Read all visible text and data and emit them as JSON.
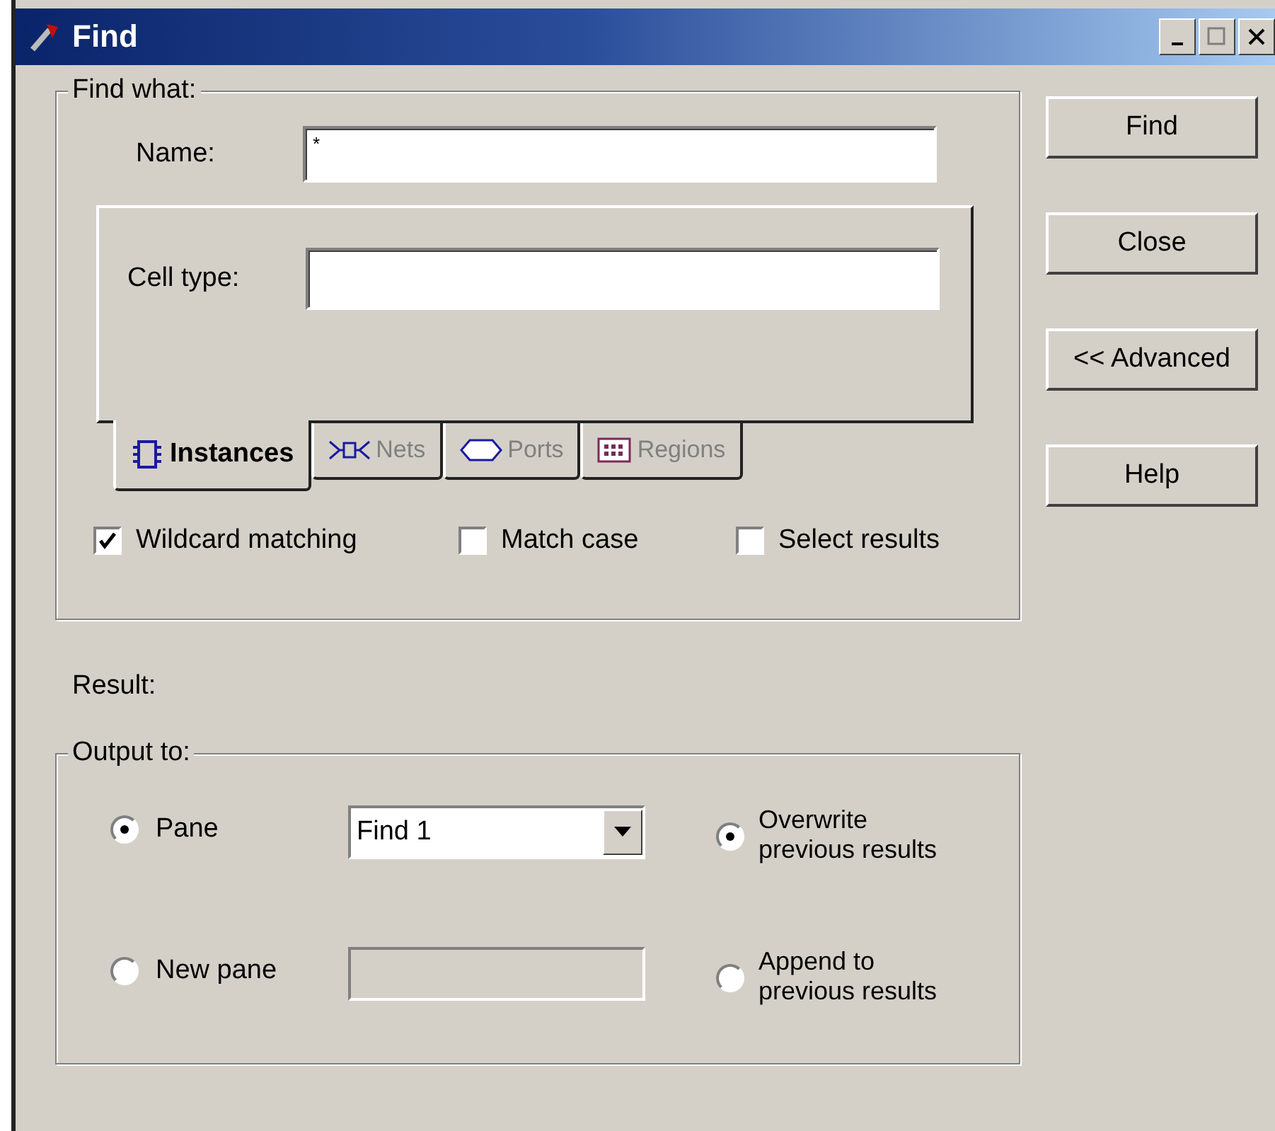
{
  "window": {
    "title": "Find"
  },
  "find_what": {
    "label": "Find what:",
    "name_field": {
      "label": "Name:",
      "value": "*"
    },
    "cell_type_field": {
      "label": "Cell type:"
    },
    "tabs": [
      {
        "label": "Instances",
        "kind": "instances",
        "selected": true
      },
      {
        "label": "Nets",
        "kind": "nets",
        "selected": false
      },
      {
        "label": "Ports",
        "kind": "ports",
        "selected": false
      },
      {
        "label": "Regions",
        "kind": "regions",
        "selected": false
      }
    ],
    "options": [
      {
        "label": "Wildcard matching",
        "checked": true
      },
      {
        "label": "Match case",
        "checked": false
      },
      {
        "label": "Select results",
        "checked": false
      }
    ]
  },
  "result": {
    "label": "Result:"
  },
  "output_to": {
    "label": "Output to:",
    "targets": [
      {
        "label": "Pane",
        "kind": "dropdown",
        "value": "Find 1",
        "selected": true
      },
      {
        "label": "New pane",
        "kind": "field",
        "disabled": true,
        "selected": false
      }
    ],
    "modes": [
      {
        "label": "Overwrite previous results",
        "selected": true
      },
      {
        "label": "Append to previous results",
        "selected": false
      }
    ]
  },
  "buttons": [
    "Find",
    "Close",
    "<< Advanced",
    "Help"
  ]
}
